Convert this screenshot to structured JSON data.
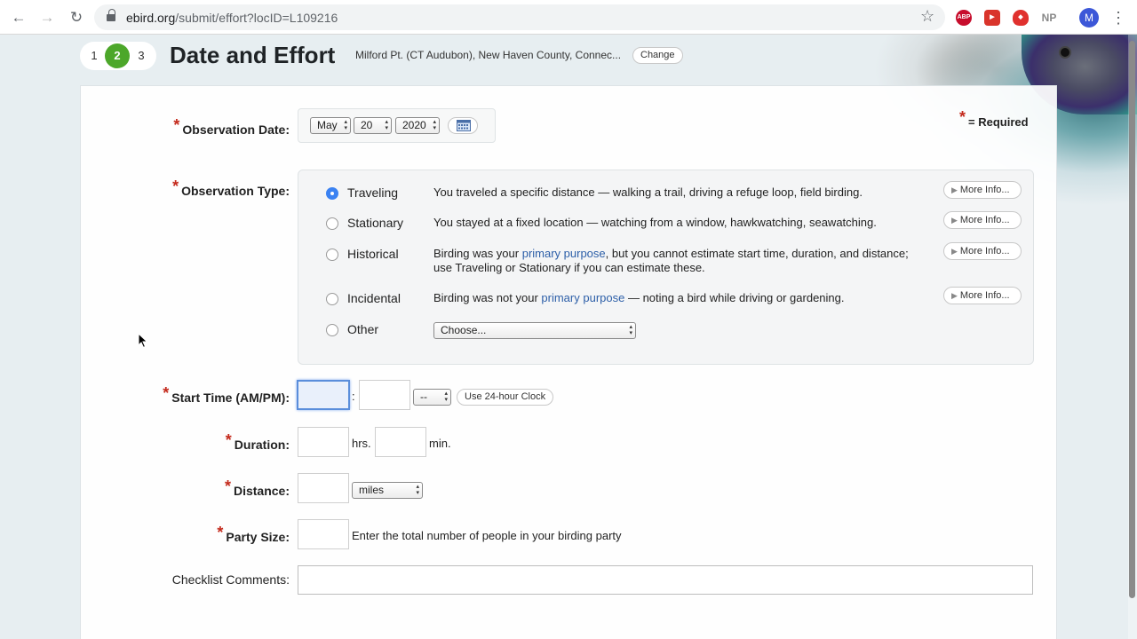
{
  "browser": {
    "url_host": "ebird.org",
    "url_path": "/submit/effort?locID=L109216",
    "back_icon": "←",
    "forward_icon": "→",
    "reload_icon": "↻",
    "star_icon": "☆",
    "extensions": {
      "abp": "ABP",
      "np": "NP"
    },
    "avatar_letter": "M",
    "menu_icon": "⋮"
  },
  "steps": [
    "1",
    "2",
    "3"
  ],
  "page_title": "Date and Effort",
  "location": {
    "name": "Milford Pt. (CT Audubon), New Haven County, Connec...",
    "change_label": "Change"
  },
  "required_note": "= Required",
  "required_mark": "*",
  "observation_date": {
    "label": "Observation Date:",
    "month": "May",
    "day": "20",
    "year": "2020"
  },
  "observation_type": {
    "label": "Observation Type:",
    "more_info_label": "More Info...",
    "options": [
      {
        "name": "Traveling",
        "selected": true,
        "desc_before": "You traveled a specific distance — walking a trail, driving a refuge loop, field birding.",
        "link": "",
        "desc_after": ""
      },
      {
        "name": "Stationary",
        "selected": false,
        "desc_before": "You stayed at a fixed location — watching from a window, hawkwatching, seawatching.",
        "link": "",
        "desc_after": ""
      },
      {
        "name": "Historical",
        "selected": false,
        "desc_before": "Birding was your ",
        "link": "primary purpose",
        "desc_after": ", but you cannot estimate start time, duration, and distance; use Traveling or Stationary if you can estimate these."
      },
      {
        "name": "Incidental",
        "selected": false,
        "desc_before": "Birding was not your ",
        "link": "primary purpose",
        "desc_after": " — noting a bird while driving or gardening."
      },
      {
        "name": "Other",
        "selected": false
      }
    ],
    "other_select": "Choose..."
  },
  "start_time": {
    "label": "Start Time (AM/PM):",
    "separator": ":",
    "ampm": "--",
    "clock_button": "Use 24-hour Clock"
  },
  "duration": {
    "label": "Duration:",
    "hrs_unit": "hrs.",
    "min_unit": "min."
  },
  "distance": {
    "label": "Distance:",
    "unit": "miles"
  },
  "party_size": {
    "label": "Party Size:",
    "hint": "Enter the total number of people in your birding party"
  },
  "comments": {
    "label": "Checklist Comments:"
  }
}
